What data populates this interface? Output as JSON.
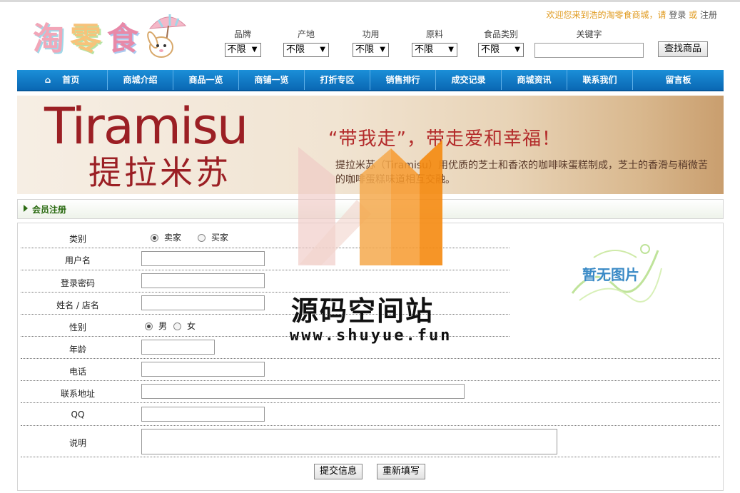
{
  "logo": {
    "chars": [
      "淘",
      "零",
      "食"
    ]
  },
  "welcome": {
    "prefix": "欢迎您来到浩的淘零食商城，请 ",
    "login": "登录",
    "or": " 或 ",
    "register": "注册"
  },
  "filters": [
    {
      "label": "品牌",
      "value": "不限"
    },
    {
      "label": "产地",
      "value": "不限"
    },
    {
      "label": "功用",
      "value": "不限"
    },
    {
      "label": "原料",
      "value": "不限"
    },
    {
      "label": "食品类别",
      "value": "不限"
    }
  ],
  "keyword": {
    "label": "关键字",
    "value": ""
  },
  "search_button": "查找商品",
  "nav": [
    "首页",
    "商城介绍",
    "商品一览",
    "商铺一览",
    "打折专区",
    "销售排行",
    "成交记录",
    "商城资讯",
    "联系我们",
    "留言板"
  ],
  "banner": {
    "title_en": "Tiramisu",
    "title_cn": "提拉米苏",
    "slogan": "“带我走”，带走爱和幸福！",
    "desc": "提拉米苏（Tiramisu）用优质的芝士和香浓的咖啡味蛋糕制成，芝士的香滑与稍微苦的咖啡蛋糕味道相互交融。"
  },
  "section_title": "会员注册",
  "form": {
    "category": {
      "label": "类别",
      "options": [
        "卖家",
        "买家"
      ],
      "selected": "卖家"
    },
    "username": {
      "label": "用户名",
      "value": ""
    },
    "password": {
      "label": "登录密码",
      "value": ""
    },
    "name": {
      "label": "姓名 / 店名",
      "value": ""
    },
    "gender": {
      "label": "性别",
      "options": [
        "男",
        "女"
      ],
      "selected": "男"
    },
    "age": {
      "label": "年龄",
      "value": ""
    },
    "phone": {
      "label": "电话",
      "value": ""
    },
    "address": {
      "label": "联系地址",
      "value": ""
    },
    "qq": {
      "label": "QQ",
      "value": ""
    },
    "note": {
      "label": "说明",
      "value": ""
    },
    "no_image": "暂无图片",
    "submit": "提交信息",
    "reset": "重新填写"
  },
  "watermark": {
    "title": "源码空间站",
    "url": "www.shuyue.fun"
  },
  "colors": {
    "nav_bg": "#0a75c2",
    "brand_red": "#9b1f24",
    "section_green": "#2b6b12",
    "welcome_orange": "#e09a1e"
  }
}
